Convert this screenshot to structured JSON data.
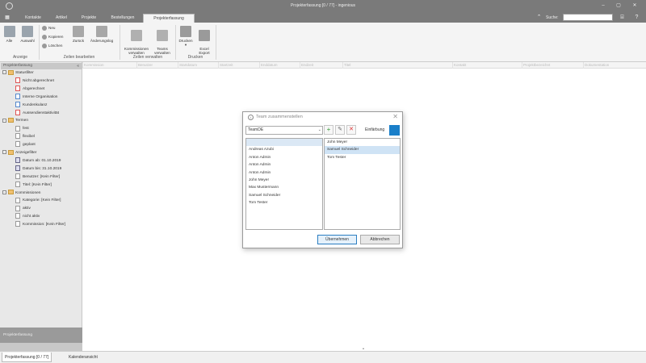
{
  "window": {
    "title": "Projekterfassung [0 / 77] - ingenious",
    "controls": [
      "–",
      "▢",
      "✕"
    ]
  },
  "menu": {
    "file_icon": "grid-menu-icon",
    "tabs": [
      "Kontakte",
      "Artikel",
      "Projekte",
      "Bestellungen",
      "Projekterfassung"
    ],
    "active_tab": "Projekterfassung",
    "collapse_glyph": "⌃",
    "search_label": "Suche:",
    "search_value": "",
    "icons": [
      "gift-icon",
      "help-icon"
    ]
  },
  "ribbon": {
    "groups": [
      {
        "label": "Anzeige",
        "buttons": [
          "Alle",
          "Auswahl"
        ]
      },
      {
        "label": "Zeilen bearbeiten",
        "small_buttons": [
          "Neu",
          "Kopieren",
          "Löschen"
        ],
        "buttons": [
          "Zurück",
          "Änderungslog"
        ]
      },
      {
        "label": "Zeilen verwalten",
        "buttons": [
          "Kommissionen\nverwalten",
          "Teams\nverwalten"
        ]
      },
      {
        "label": "Drucken",
        "buttons": [
          "Drucken",
          "Excel\nExport"
        ]
      }
    ],
    "print_dropdown": "▾"
  },
  "sidebar": {
    "header": "Projekterfassung",
    "pin": "«",
    "tree": [
      {
        "type": "group",
        "label": "Statusfilter",
        "level": 0
      },
      {
        "type": "leaf",
        "label": "Nicht abgerechnet",
        "level": 1,
        "icon": "red"
      },
      {
        "type": "leaf",
        "label": "Abgerechnet",
        "level": 1,
        "icon": "red"
      },
      {
        "type": "leaf",
        "label": "Interne Organisation",
        "level": 1,
        "icon": "blue"
      },
      {
        "type": "leaf",
        "label": "Kundenkulanz",
        "level": 1,
        "icon": "blue"
      },
      {
        "type": "leaf",
        "label": "Aussendienstaktivität",
        "level": 1,
        "icon": "red"
      },
      {
        "type": "group",
        "label": "Termen",
        "level": 0
      },
      {
        "type": "leaf",
        "label": "fest",
        "level": 1,
        "icon": "plain"
      },
      {
        "type": "leaf",
        "label": "flexibel",
        "level": 1,
        "icon": "plain"
      },
      {
        "type": "leaf",
        "label": "geplant",
        "level": 1,
        "icon": "plain"
      },
      {
        "type": "group",
        "label": "Anzeigefilter",
        "level": 0
      },
      {
        "type": "leaf",
        "label": "Datum ab: 01.10.2019",
        "level": 1,
        "icon": "cal"
      },
      {
        "type": "leaf",
        "label": "Datum bis: 31.10.2019",
        "level": 1,
        "icon": "cal"
      },
      {
        "type": "leaf",
        "label": "Benutzer: [Kein Filter]",
        "level": 1,
        "icon": "plain"
      },
      {
        "type": "leaf",
        "label": "Titel: [Kein Filter]",
        "level": 1,
        "icon": "plain"
      },
      {
        "type": "group",
        "label": "Kommissionen",
        "level": 0
      },
      {
        "type": "leaf",
        "label": "Kategorie: [Kein Filter]",
        "level": 1,
        "icon": "plain"
      },
      {
        "type": "leaf",
        "label": "aktiv",
        "level": 1,
        "icon": "plain"
      },
      {
        "type": "leaf",
        "label": "nicht aktiv",
        "level": 1,
        "icon": "plain"
      },
      {
        "type": "leaf",
        "label": "Kommission: [Kein Filter]",
        "level": 1,
        "icon": "plain"
      }
    ],
    "bottom_panel": "Projekterfassung"
  },
  "grid": {
    "columns": [
      "Kommission",
      "Benutzer",
      "Startdatum",
      "Startzeit",
      "Enddatum",
      "Endzeit",
      "Titel",
      "Kontakt",
      "Projektbezeichnt",
      "Dokumentation"
    ]
  },
  "status_tabs": [
    "Projekterfassung [0 / 77]",
    "Kalenderansicht"
  ],
  "dialog": {
    "title": "Team zusammenstellen",
    "team_value": "TeamDE",
    "dropdown_glyph": "⌄",
    "add_glyph": "+",
    "edit_glyph": "✎",
    "delete_glyph": "✕",
    "color_label": "Einfärbung",
    "color": "#1a7fc9",
    "available_members": [
      "",
      "Andreas Azubi",
      "Anton Admin",
      "Anton Admin",
      "Anton Admin",
      "John Meyer",
      "Max Mustermann",
      "Samuel Schneider",
      "Tom Tester"
    ],
    "team_members": [
      "John Meyer",
      "Samuel Schneider",
      "Tom Tester"
    ],
    "selected_member": "Samuel Schneider",
    "ok_label": "Übernehmen",
    "cancel_label": "Abbrechen",
    "close_glyph": "✕"
  }
}
